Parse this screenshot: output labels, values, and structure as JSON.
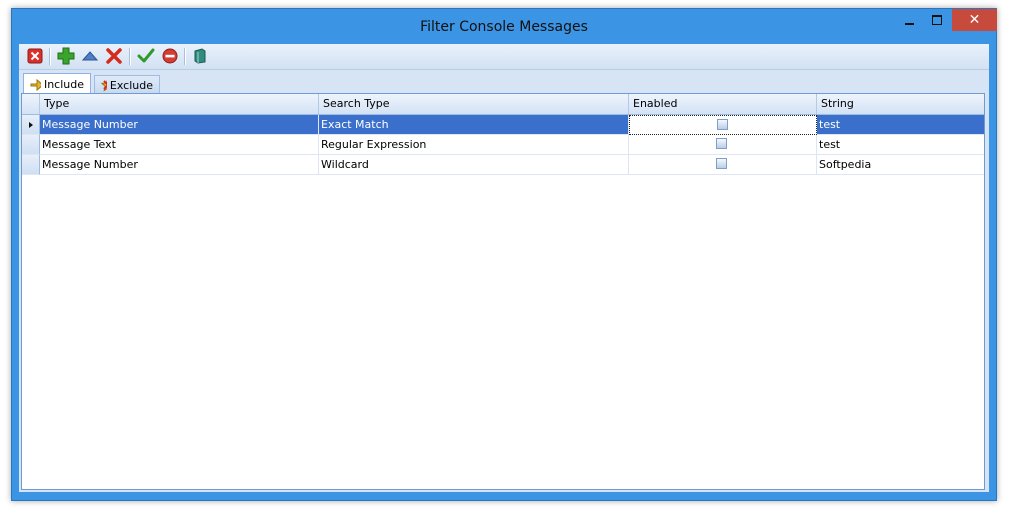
{
  "window": {
    "title": "Filter Console Messages",
    "controls": {
      "minimize": "minimize",
      "maximize": "maximize",
      "close": "close"
    }
  },
  "toolbar": {
    "buttons": [
      {
        "icon": "delete-filter-icon",
        "color": "#d9302a"
      },
      {
        "icon": "add-icon",
        "color": "#3aa42c"
      },
      {
        "icon": "move-up-icon",
        "color": "#4f7fc9"
      },
      {
        "icon": "remove-icon",
        "color": "#d62a1f"
      },
      {
        "icon": "check-icon",
        "color": "#2f9a2a"
      },
      {
        "icon": "stop-icon",
        "color": "#d63b34"
      },
      {
        "icon": "book-icon",
        "color": "#2f8c7e"
      }
    ]
  },
  "tabs": [
    {
      "label": "Include",
      "icon": "include-icon",
      "active": true
    },
    {
      "label": "Exclude",
      "icon": "exclude-icon",
      "active": false
    }
  ],
  "grid": {
    "columns": [
      "Type",
      "Search Type",
      "Enabled",
      "String"
    ],
    "rows": [
      {
        "type": "Message Number",
        "search_type": "Exact Match",
        "enabled": false,
        "string": "test",
        "selected": true
      },
      {
        "type": "Message Text",
        "search_type": "Regular Expression",
        "enabled": false,
        "string": "test",
        "selected": false
      },
      {
        "type": "Message Number",
        "search_type": "Wildcard",
        "enabled": false,
        "string": "Softpedia",
        "selected": false
      }
    ]
  },
  "colors": {
    "frame": "#3c94e4",
    "selection": "#3a6fcc",
    "close_button": "#c74b3c"
  }
}
